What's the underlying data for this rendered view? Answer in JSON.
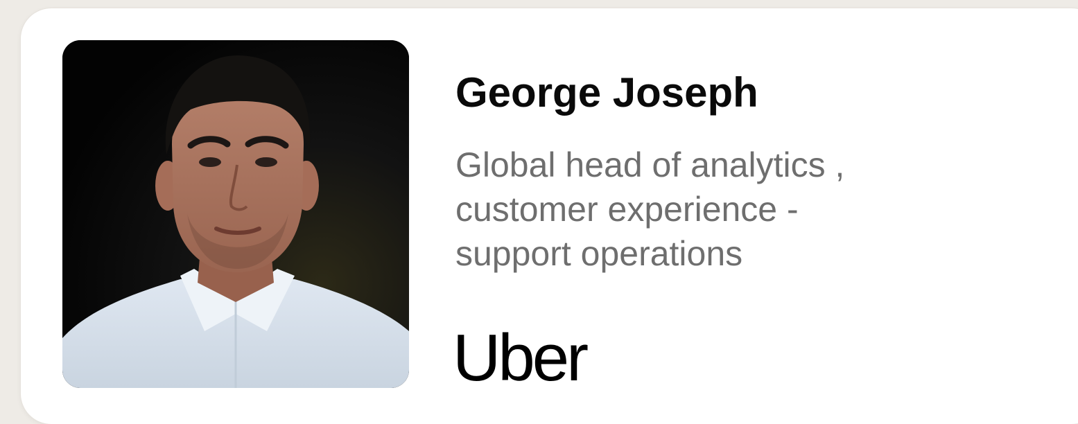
{
  "profile": {
    "name": "George Joseph",
    "title_lines": [
      "Global head of analytics ,",
      "customer experience -",
      "support operations"
    ],
    "company": "Uber"
  },
  "colors": {
    "background": "#eeebe6",
    "card": "#ffffff",
    "name_text": "#0a0a0a",
    "title_text": "#6e6e6e"
  }
}
